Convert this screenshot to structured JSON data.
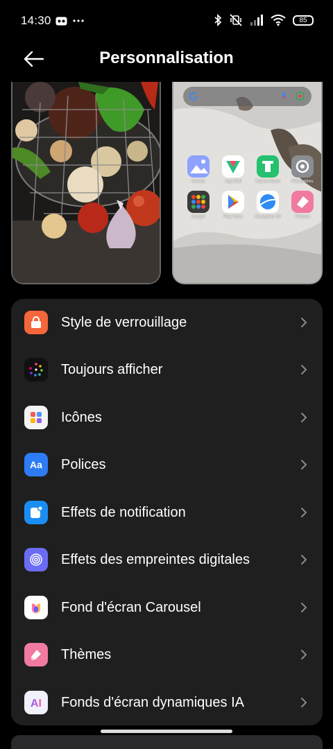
{
  "status_bar": {
    "time": "14:30",
    "battery": "85"
  },
  "header": {
    "title": "Personnalisation"
  },
  "preview": {
    "apps": [
      {
        "label": "Galerie",
        "icon": "gallery-icon",
        "color": "#7b8ff5"
      },
      {
        "label": "App Mall",
        "icon": "app-mall-icon",
        "color": "#ffffff"
      },
      {
        "label": "Xiaomi Home",
        "icon": "xiaomi-home-icon",
        "color": "#25c16f"
      },
      {
        "label": "Paramètres",
        "icon": "settings-icon",
        "color": "#8a8d92"
      },
      {
        "label": "Google",
        "icon": "google-folder-icon",
        "color": "#3a3a3a"
      },
      {
        "label": "Play Store",
        "icon": "play-store-icon",
        "color": "#ffffff"
      },
      {
        "label": "Navigateur Mi",
        "icon": "browser-icon",
        "color": "#2e8cf5"
      },
      {
        "label": "Thèmes",
        "icon": "themes-icon",
        "color": "#f07aa0"
      }
    ]
  },
  "settings": {
    "items": [
      {
        "label": "Style de verrouillage",
        "icon": "lock-icon",
        "color": "#f5663a"
      },
      {
        "label": "Toujours afficher",
        "icon": "always-on-display-icon",
        "color": "#111111"
      },
      {
        "label": "Icônes",
        "icon": "icons-grid-icon",
        "color": "#f4f4f4"
      },
      {
        "label": "Polices",
        "icon": "font-icon",
        "color": "#2d7cf6"
      },
      {
        "label": "Effets de notification",
        "icon": "notification-icon",
        "color": "#1b8ef5"
      },
      {
        "label": "Effets des empreintes digitales",
        "icon": "fingerprint-icon",
        "color": "#6b6cf5"
      },
      {
        "label": "Fond d'écran Carousel",
        "icon": "carousel-icon",
        "color": "#ffffff"
      },
      {
        "label": "Thèmes",
        "icon": "themes-icon",
        "color": "#f07aa0"
      },
      {
        "label": "Fonds d'écran dynamiques IA",
        "icon": "ai-icon",
        "color": "#f2f0fa"
      }
    ]
  }
}
